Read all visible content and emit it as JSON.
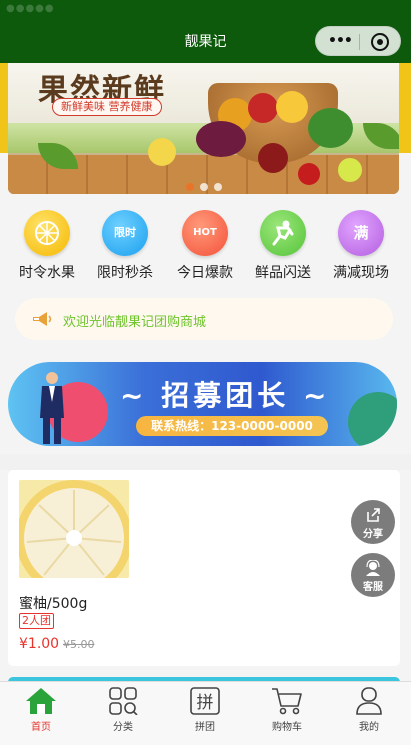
{
  "nav": {
    "title": "靓果记",
    "more_label": "•••"
  },
  "banner": {
    "headline": "果然新鲜",
    "tagline": "新鲜美味 营养健康",
    "slide_count": 3,
    "active_slide": 0
  },
  "categories": [
    {
      "label": "时令水果",
      "icon": "orange-slice-icon",
      "color": "#f5b800",
      "glyph": ""
    },
    {
      "label": "限时秒杀",
      "icon": "limited-time-icon",
      "color": "#1aa0ef",
      "glyph": "限时"
    },
    {
      "label": "今日爆款",
      "icon": "hot-icon",
      "color": "#f4513a",
      "glyph": "HOT"
    },
    {
      "label": "鲜品闪送",
      "icon": "delivery-runner-icon",
      "color": "#55c43a",
      "glyph": ""
    },
    {
      "label": "满减现场",
      "icon": "discount-icon",
      "color": "#b45ee0",
      "glyph": "满"
    }
  ],
  "notice": {
    "text": "欢迎光临靓果记团购商城",
    "icon": "speaker-icon"
  },
  "recruit": {
    "title": "~ 招募团长 ~",
    "hotline": "联系热线：123-0000-0000"
  },
  "product": {
    "name": "蜜柚/500g",
    "group_tag": "2人团",
    "price": "¥1.00",
    "original_price": "¥5.00"
  },
  "floating": {
    "share_label": "分享",
    "service_label": "客服"
  },
  "tabs": [
    {
      "label": "首页",
      "icon": "home-icon",
      "active": true
    },
    {
      "label": "分类",
      "icon": "category-grid-icon",
      "active": false
    },
    {
      "label": "拼团",
      "icon": "group-buy-icon",
      "active": false
    },
    {
      "label": "购物车",
      "icon": "cart-icon",
      "active": false
    },
    {
      "label": "我的",
      "icon": "user-icon",
      "active": false
    }
  ],
  "colors": {
    "nav_bg": "#0d5a0d",
    "accent_red": "#e8332c",
    "notice_green": "#6ec42b",
    "tab_active": "#2aa33a"
  }
}
